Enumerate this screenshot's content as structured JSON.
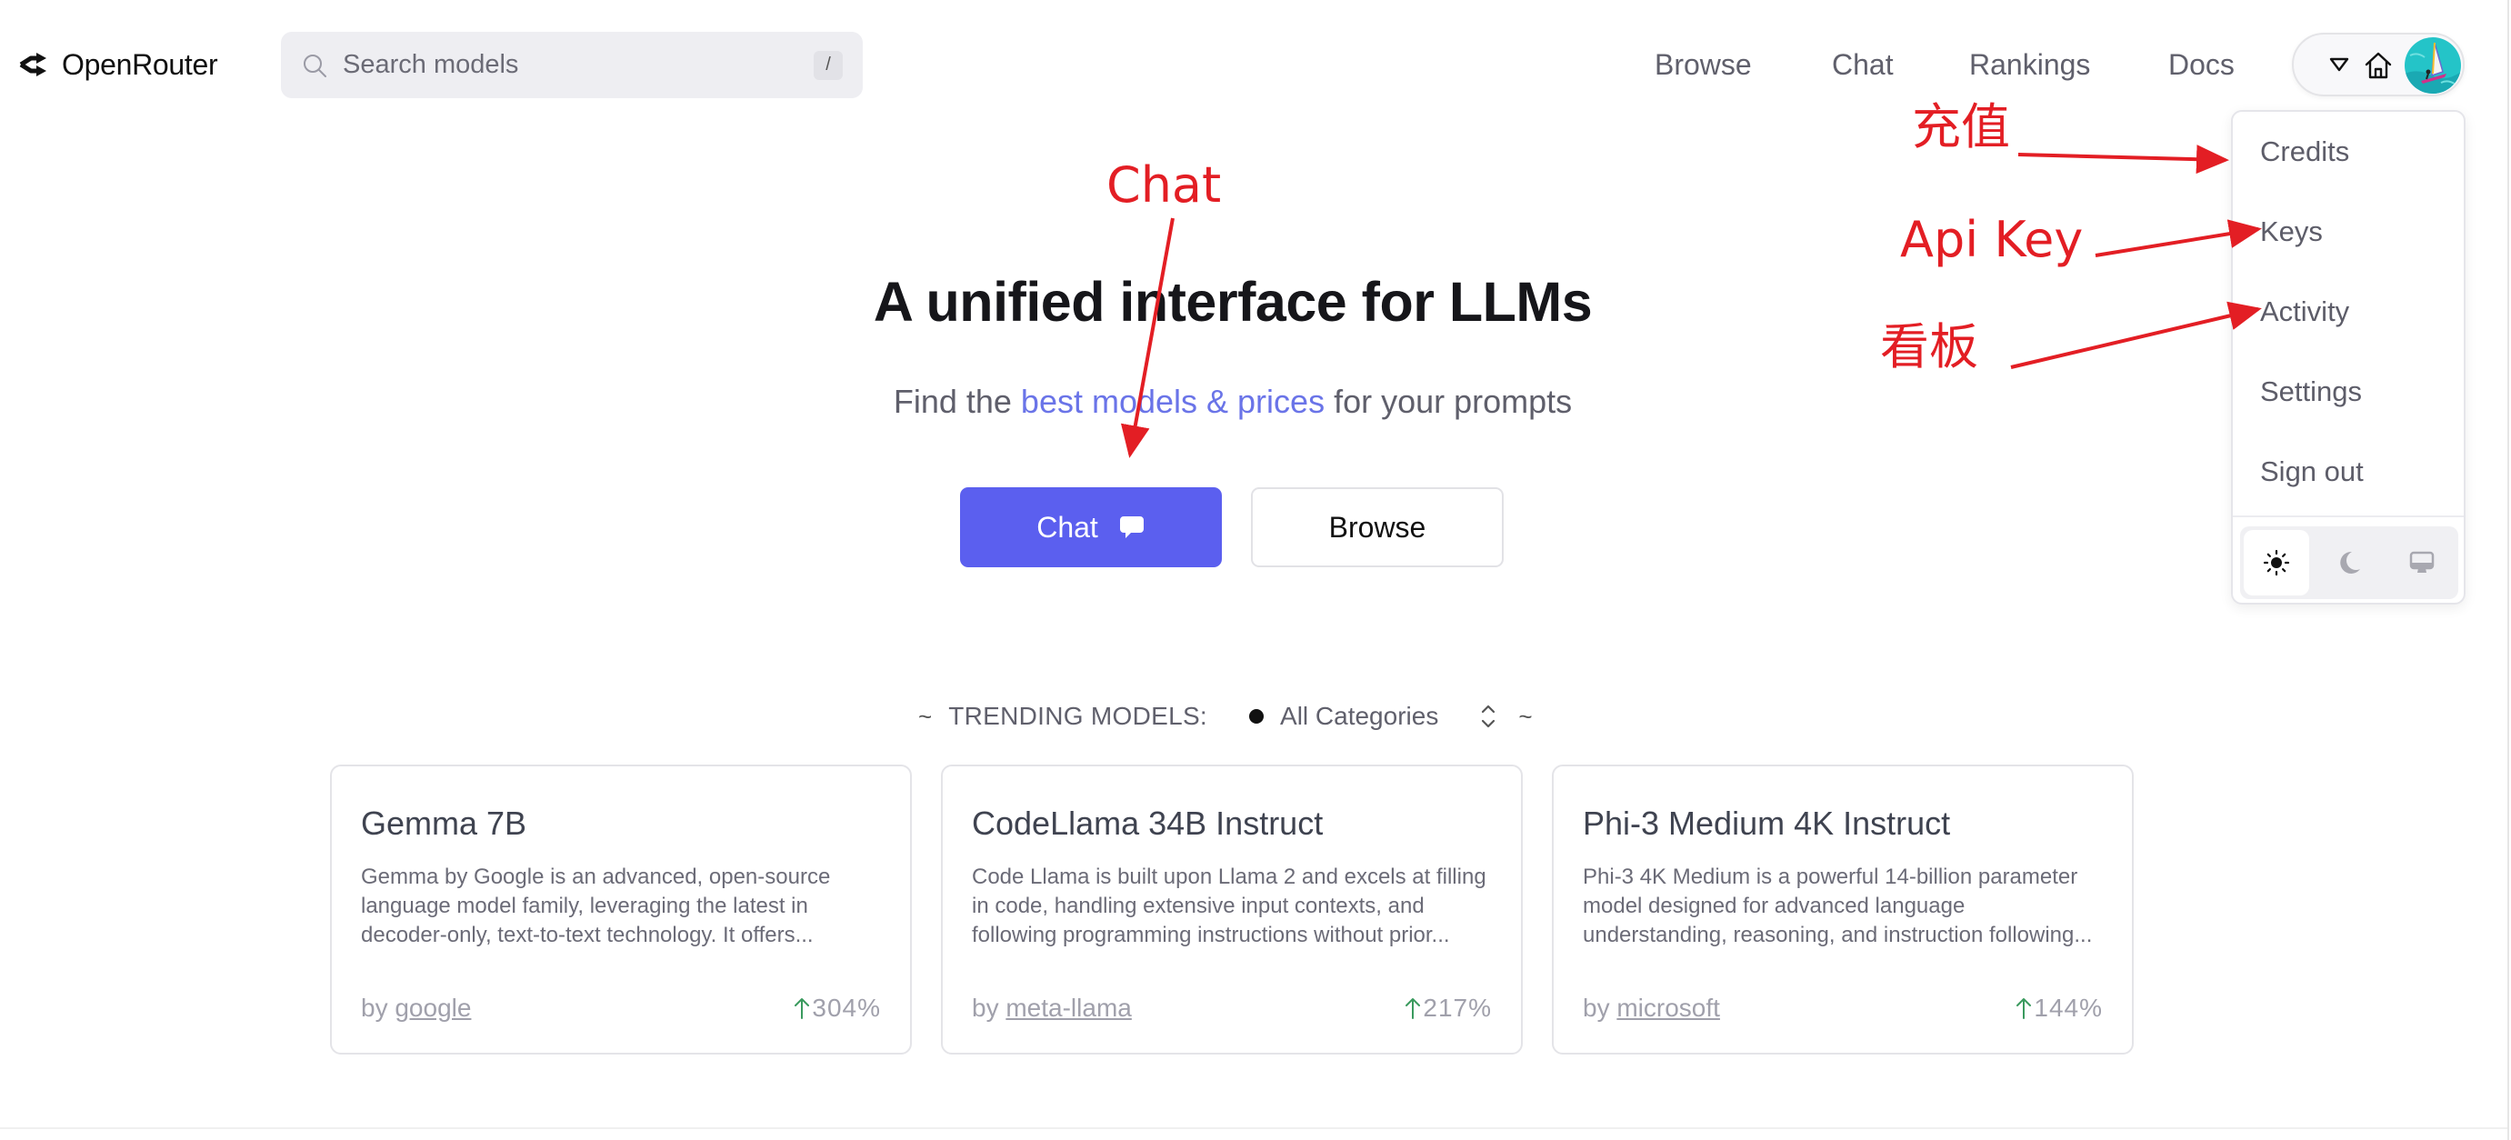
{
  "header": {
    "logo_text": "OpenRouter",
    "search": {
      "placeholder": "Search models",
      "value": "",
      "shortcut": "/"
    },
    "nav": [
      {
        "label": "Browse"
      },
      {
        "label": "Chat"
      },
      {
        "label": "Rankings"
      },
      {
        "label": "Docs"
      }
    ],
    "user_menu": {
      "caret_icon": "caret-down-icon",
      "home_icon": "home-icon",
      "avatar": "windsurfer-avatar"
    }
  },
  "dropdown": {
    "items": [
      {
        "label": "Credits"
      },
      {
        "label": "Keys"
      },
      {
        "label": "Activity"
      },
      {
        "label": "Settings"
      },
      {
        "label": "Sign out"
      }
    ],
    "theme": {
      "options": [
        "light",
        "dark",
        "system"
      ],
      "selected": "light"
    }
  },
  "hero": {
    "title": "A unified interface for LLMs",
    "subtitle_prefix": "Find the ",
    "subtitle_link": "best models & prices",
    "subtitle_suffix": " for your prompts",
    "chat_button": "Chat",
    "browse_button": "Browse"
  },
  "trending": {
    "tilde_left": "~",
    "label": "TRENDING MODELS:",
    "category": "All Categories",
    "tilde_right": "~",
    "models": [
      {
        "name": "Gemma 7B",
        "description": "Gemma by Google is an advanced, open-source language model family, leveraging the latest in decoder-only, text-to-text technology. It offers...",
        "by_prefix": "by ",
        "author": "google",
        "growth": "304%"
      },
      {
        "name": "CodeLlama 34B Instruct",
        "description": "Code Llama is built upon Llama 2 and excels at filling in code, handling extensive input contexts, and following programming instructions without prior...",
        "by_prefix": "by ",
        "author": "meta-llama",
        "growth": "217%"
      },
      {
        "name": "Phi-3 Medium 4K Instruct",
        "description": "Phi-3 4K Medium is a powerful 14-billion parameter model designed for advanced language understanding, reasoning, and instruction following...",
        "by_prefix": "by ",
        "author": "microsoft",
        "growth": "144%"
      }
    ]
  },
  "annotations": {
    "chat": "Chat",
    "credits": "充值",
    "keys": "Api Key",
    "activity": "看板",
    "color": "#e31e24"
  },
  "colors": {
    "accent": "#5b5fef",
    "link": "#6a74e8",
    "growth_arrow": "#3a9a5e"
  }
}
